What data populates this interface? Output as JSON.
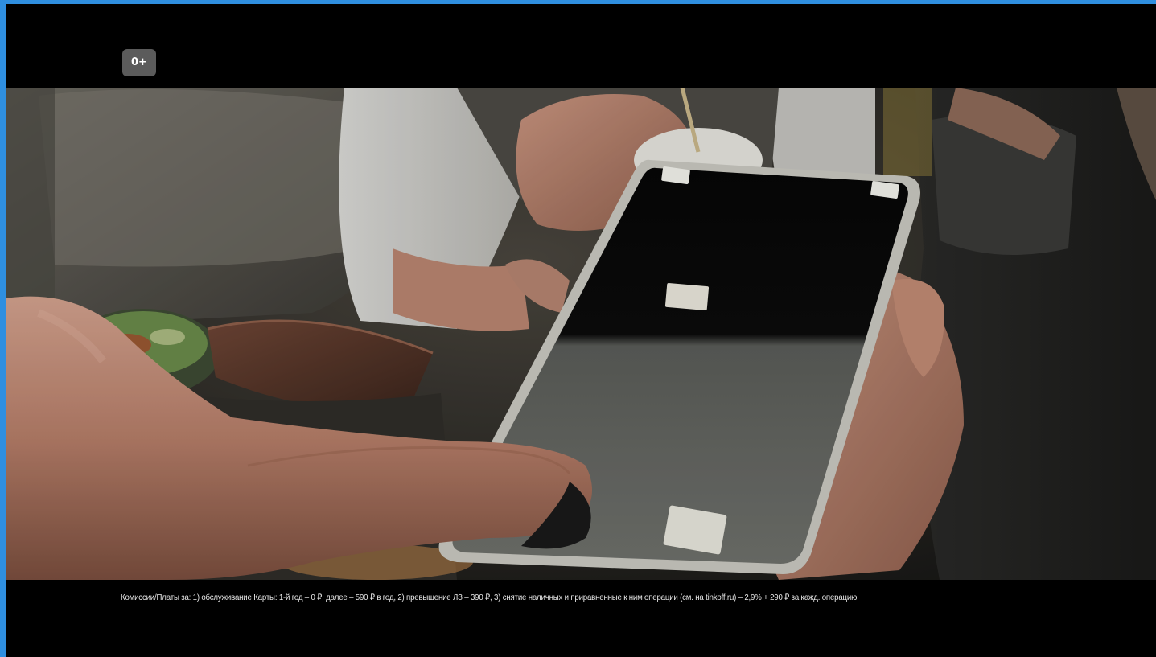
{
  "player": {
    "age_rating": "0+",
    "disclaimer": "Комиссии/Платы за: 1) обслуживание Карты: 1-й год – 0 ₽, далее – 590 ₽ в год, 2) превышение ЛЗ – 390 ₽, 3) снятие наличных и приравненные к ним операции (см. на tinkoff.ru) – 2,9% + 290 ₽ за кажд. операцию;",
    "accent_color": "#2f8fe0"
  }
}
